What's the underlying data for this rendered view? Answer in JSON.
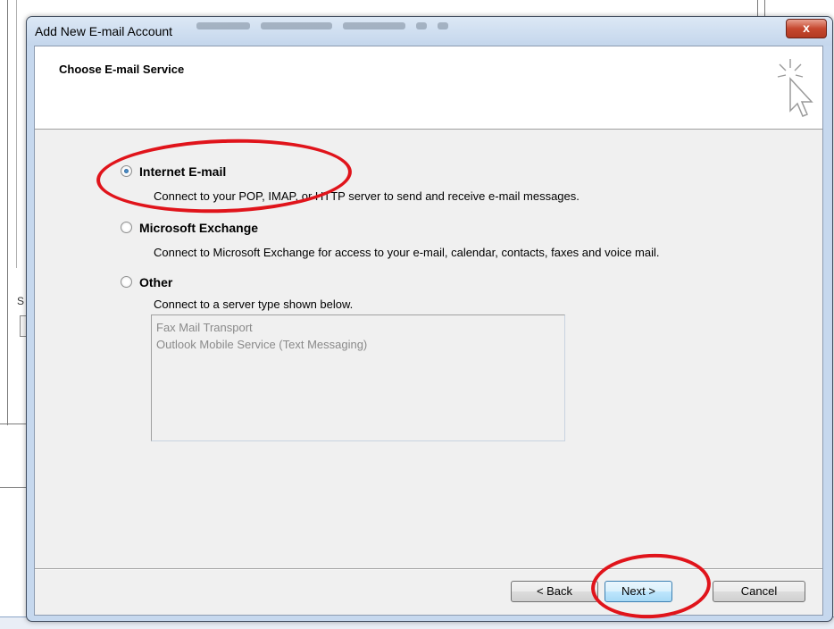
{
  "dialog": {
    "title": "Add New E-mail Account",
    "close_glyph": "x",
    "header_title": "Choose E-mail Service"
  },
  "options": [
    {
      "label": "Internet E-mail",
      "description": "Connect to your POP, IMAP, or HTTP server to send and receive e-mail messages.",
      "selected": true
    },
    {
      "label": "Microsoft Exchange",
      "description": "Connect to Microsoft Exchange for access to your e-mail, calendar, contacts, faxes and voice mail.",
      "selected": false
    },
    {
      "label": "Other",
      "description": "Connect to a server type shown below.",
      "selected": false
    }
  ],
  "other_list": [
    "Fax Mail Transport",
    "Outlook Mobile Service (Text Messaging)"
  ],
  "buttons": {
    "back": "< Back",
    "next": "Next >",
    "cancel": "Cancel"
  },
  "background": {
    "fragment_s": "S"
  },
  "colors": {
    "annotation": "#e0141b",
    "title_bar": "#c4d6ec",
    "close_button": "#c6482f"
  },
  "icons": {
    "header": "cursor-click-icon"
  }
}
